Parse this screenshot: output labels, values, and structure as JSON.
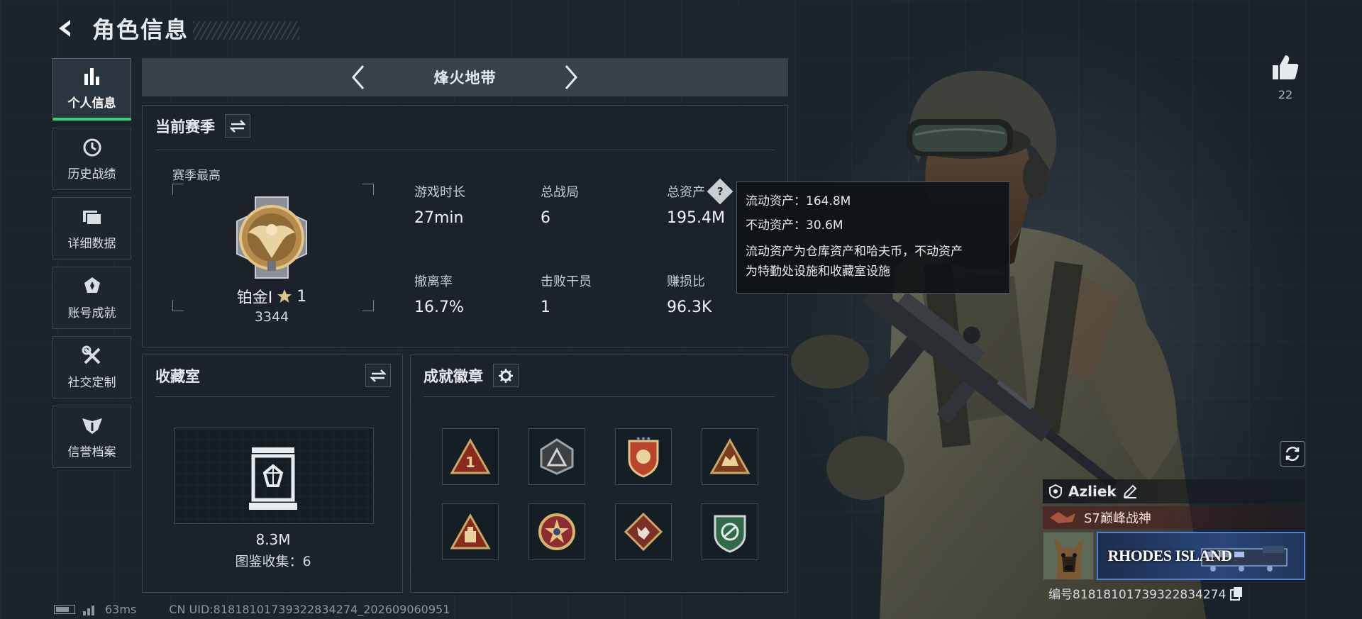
{
  "header": {
    "title": "角色信息"
  },
  "sidebar": {
    "items": [
      {
        "label": "个人信息",
        "active": true
      },
      {
        "label": "历史战绩"
      },
      {
        "label": "详细数据"
      },
      {
        "label": "账号成就"
      },
      {
        "label": "社交定制"
      },
      {
        "label": "信誉档案"
      }
    ]
  },
  "mode": {
    "title": "烽火地带"
  },
  "season": {
    "title": "当前赛季",
    "best_label": "赛季最高",
    "rank_name": "铂金Ⅰ",
    "rank_stars": "1",
    "rank_score": "3344",
    "stats": [
      {
        "label": "游戏时长",
        "value": "27min"
      },
      {
        "label": "总战局",
        "value": "6"
      },
      {
        "label": "总资产",
        "value": "195.4M"
      },
      {
        "label": "撤离率",
        "value": "16.7%"
      },
      {
        "label": "击败干员",
        "value": "1"
      },
      {
        "label": "赚损比",
        "value": "96.3K"
      }
    ]
  },
  "tooltip": {
    "liquid": "流动资产：164.8M",
    "fixed": "不动资产：30.6M",
    "desc_line1": "流动资产为仓库资产和哈夫币，不动资产",
    "desc_line2": "为特勤处设施和收藏室设施"
  },
  "collection": {
    "title": "收藏室",
    "value": "8.3M",
    "count": "图鉴收集：6"
  },
  "achievements": {
    "title": "成就徽章"
  },
  "like": {
    "count": "22"
  },
  "profile": {
    "name": "Azliek",
    "title": "S7巅峰战神",
    "banner_text": "RHODES ISLAND",
    "uid": "编号818181017393228342​74"
  },
  "footer": {
    "ping": "63ms",
    "uid": "CN UID:818181017393228342​74_202609060951"
  },
  "colors": {
    "accent_green": "#2fd37a",
    "panel_bg": "#1c232b",
    "banner_blue": "#4e7fd8"
  }
}
